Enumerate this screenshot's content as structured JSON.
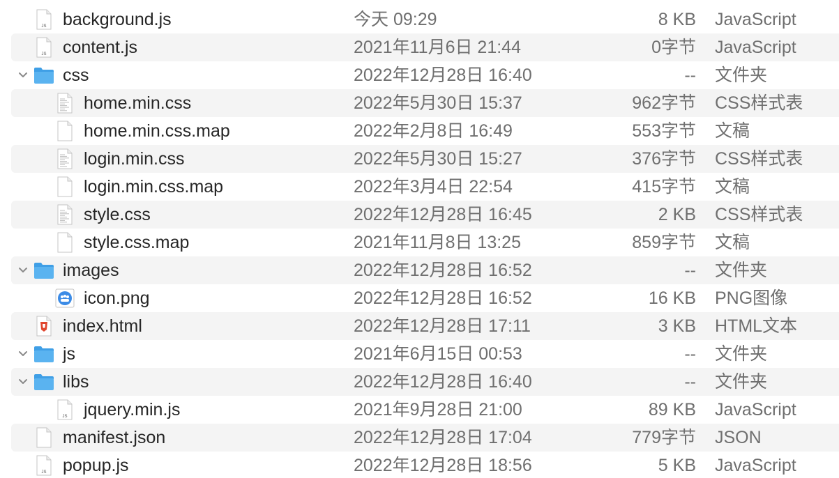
{
  "files": [
    {
      "name": "background.js",
      "date": "今天 09:29",
      "size": "8 KB",
      "kind": "JavaScript",
      "icon": "js-file-icon",
      "level": 0,
      "expandable": false
    },
    {
      "name": "content.js",
      "date": "2021年11月6日 21:44",
      "size": "0字节",
      "kind": "JavaScript",
      "icon": "js-file-icon",
      "level": 0,
      "expandable": false
    },
    {
      "name": "css",
      "date": "2022年12月28日 16:40",
      "size": "--",
      "kind": "文件夹",
      "icon": "folder-icon",
      "level": 0,
      "expandable": true
    },
    {
      "name": "home.min.css",
      "date": "2022年5月30日 15:37",
      "size": "962字节",
      "kind": "CSS样式表",
      "icon": "css-file-icon",
      "level": 1,
      "expandable": false
    },
    {
      "name": "home.min.css.map",
      "date": "2022年2月8日 16:49",
      "size": "553字节",
      "kind": "文稿",
      "icon": "document-icon",
      "level": 1,
      "expandable": false
    },
    {
      "name": "login.min.css",
      "date": "2022年5月30日 15:27",
      "size": "376字节",
      "kind": "CSS样式表",
      "icon": "css-file-icon",
      "level": 1,
      "expandable": false
    },
    {
      "name": "login.min.css.map",
      "date": "2022年3月4日 22:54",
      "size": "415字节",
      "kind": "文稿",
      "icon": "document-icon",
      "level": 1,
      "expandable": false
    },
    {
      "name": "style.css",
      "date": "2022年12月28日 16:45",
      "size": "2 KB",
      "kind": "CSS样式表",
      "icon": "css-file-icon",
      "level": 1,
      "expandable": false
    },
    {
      "name": "style.css.map",
      "date": "2021年11月8日 13:25",
      "size": "859字节",
      "kind": "文稿",
      "icon": "document-icon",
      "level": 1,
      "expandable": false
    },
    {
      "name": "images",
      "date": "2022年12月28日 16:52",
      "size": "--",
      "kind": "文件夹",
      "icon": "folder-icon",
      "level": 0,
      "expandable": true
    },
    {
      "name": "icon.png",
      "date": "2022年12月28日 16:52",
      "size": "16 KB",
      "kind": "PNG图像",
      "icon": "png-image-icon",
      "level": 1,
      "expandable": false
    },
    {
      "name": "index.html",
      "date": "2022年12月28日 17:11",
      "size": "3 KB",
      "kind": "HTML文本",
      "icon": "html-file-icon",
      "level": 0,
      "expandable": false
    },
    {
      "name": "js",
      "date": "2021年6月15日 00:53",
      "size": "--",
      "kind": "文件夹",
      "icon": "folder-icon",
      "level": 0,
      "expandable": true
    },
    {
      "name": "libs",
      "date": "2022年12月28日 16:40",
      "size": "--",
      "kind": "文件夹",
      "icon": "folder-icon",
      "level": 0,
      "expandable": true
    },
    {
      "name": "jquery.min.js",
      "date": "2021年9月28日 21:00",
      "size": "89 KB",
      "kind": "JavaScript",
      "icon": "js-file-icon",
      "level": 1,
      "expandable": false
    },
    {
      "name": "manifest.json",
      "date": "2022年12月28日 17:04",
      "size": "779字节",
      "kind": "JSON",
      "icon": "document-icon",
      "level": 0,
      "expandable": false
    },
    {
      "name": "popup.js",
      "date": "2022年12月28日 18:56",
      "size": "5 KB",
      "kind": "JavaScript",
      "icon": "js-file-icon",
      "level": 0,
      "expandable": false
    }
  ],
  "icon_labels": {
    "js": "JS"
  },
  "colors": {
    "folder": "#5ab3f0",
    "folder_tab": "#3f9fe6",
    "row_alt": "#f4f4f4",
    "html_badge": "#e0462e",
    "png_badge": "#3b8be6"
  }
}
